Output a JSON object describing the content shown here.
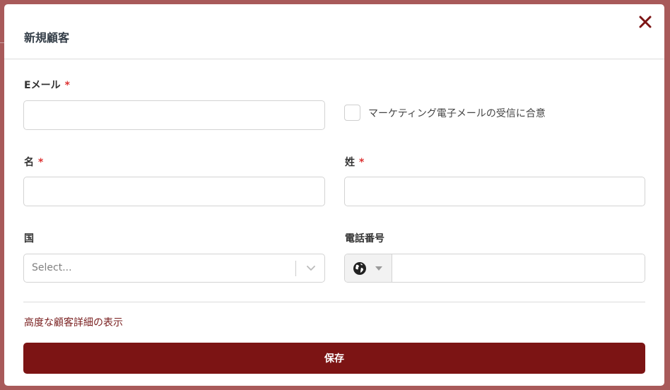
{
  "modal": {
    "title": "新規顧客",
    "close_icon": "close-icon"
  },
  "form": {
    "email": {
      "label": "Eメール",
      "required_mark": "*",
      "value": ""
    },
    "marketing_consent": {
      "label": "マーケティング電子メールの受信に合意",
      "checked": false
    },
    "first_name": {
      "label": "名",
      "required_mark": "*",
      "value": ""
    },
    "last_name": {
      "label": "姓",
      "required_mark": "*",
      "value": ""
    },
    "country": {
      "label": "国",
      "placeholder": "Select..."
    },
    "phone": {
      "label": "電話番号",
      "flag_icon": "globe-icon",
      "value": ""
    }
  },
  "advanced_link": "高度な顧客詳細の表示",
  "save_button": "保存",
  "colors": {
    "accent": "#7c1414",
    "link": "#7a2020",
    "required": "#dd3333",
    "backdrop": "#a85a5a"
  }
}
